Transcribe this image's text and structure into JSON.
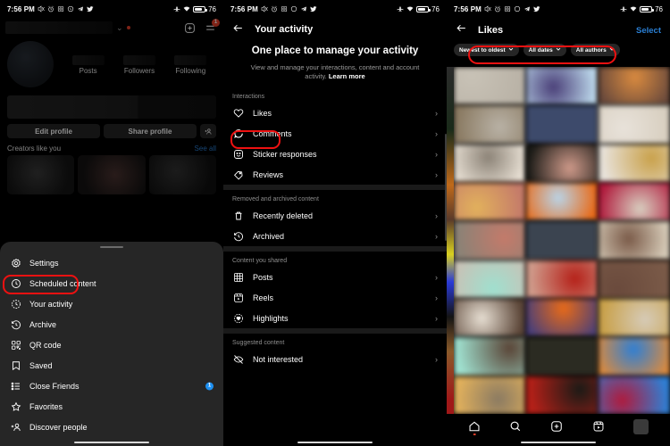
{
  "status_bar": {
    "time": "7:56 PM",
    "battery_percent": "76",
    "left_icons": [
      "mute-icon",
      "alarm-icon",
      "screenshot-icon",
      "whatsapp-icon",
      "telegram-icon",
      "twitter-icon"
    ],
    "right_icons": [
      "airplane-icon",
      "wifi-icon",
      "battery-icon"
    ]
  },
  "panel1": {
    "name": "panel-instagram-profile",
    "header": {
      "username_redacted": true,
      "chevron": "⌄",
      "add_icon": "plus-circle-icon",
      "menu_icon": "hamburger-menu-icon",
      "menu_badge": "1"
    },
    "stats": [
      {
        "label": "Posts"
      },
      {
        "label": "Followers"
      },
      {
        "label": "Following"
      }
    ],
    "buttons": {
      "edit_profile": "Edit profile",
      "share_profile": "Share profile",
      "add_person_icon": "add-person-icon"
    },
    "creators": {
      "title": "Creators like you",
      "see_all": "See all"
    },
    "sheet_items": [
      {
        "label": "Settings",
        "icon": "gear-icon",
        "badge": null,
        "highlighted": false
      },
      {
        "label": "Scheduled content",
        "icon": "clock-icon",
        "badge": null,
        "highlighted": false
      },
      {
        "label": "Your activity",
        "icon": "activity-clock-icon",
        "badge": null,
        "highlighted": true
      },
      {
        "label": "Archive",
        "icon": "archive-clock-icon",
        "badge": null,
        "highlighted": false
      },
      {
        "label": "QR code",
        "icon": "qr-code-icon",
        "badge": null,
        "highlighted": false
      },
      {
        "label": "Saved",
        "icon": "bookmark-icon",
        "badge": null,
        "highlighted": false
      },
      {
        "label": "Close Friends",
        "icon": "list-icon",
        "badge": "1",
        "highlighted": false
      },
      {
        "label": "Favorites",
        "icon": "star-icon",
        "badge": null,
        "highlighted": false
      },
      {
        "label": "Discover people",
        "icon": "discover-people-icon",
        "badge": null,
        "highlighted": false
      }
    ]
  },
  "panel2": {
    "name": "panel-your-activity",
    "back_icon": "back-arrow-icon",
    "title": "Your activity",
    "hero_title": "One place to manage your activity",
    "hero_sub_text": "View and manage your interactions, content and account activity. ",
    "hero_sub_link": "Learn more",
    "sections": [
      {
        "header": "Interactions",
        "items": [
          {
            "label": "Likes",
            "icon": "heart-icon",
            "highlighted": true
          },
          {
            "label": "Comments",
            "icon": "comment-bubble-icon",
            "highlighted": false
          },
          {
            "label": "Sticker responses",
            "icon": "sticker-face-icon",
            "highlighted": false
          },
          {
            "label": "Reviews",
            "icon": "tag-icon",
            "highlighted": false
          }
        ]
      },
      {
        "header": "Removed and archived content",
        "items": [
          {
            "label": "Recently deleted",
            "icon": "trash-icon",
            "highlighted": false
          },
          {
            "label": "Archived",
            "icon": "archive-clock-icon",
            "highlighted": false
          }
        ]
      },
      {
        "header": "Content you shared",
        "items": [
          {
            "label": "Posts",
            "icon": "grid-icon",
            "highlighted": false
          },
          {
            "label": "Reels",
            "icon": "reels-icon",
            "highlighted": false
          },
          {
            "label": "Highlights",
            "icon": "highlights-icon",
            "highlighted": false
          }
        ]
      },
      {
        "header": "Suggested content",
        "items": [
          {
            "label": "Not interested",
            "icon": "eye-off-icon",
            "highlighted": false
          }
        ]
      }
    ],
    "chevron": "›"
  },
  "panel3": {
    "name": "panel-likes",
    "back_icon": "back-arrow-icon",
    "title": "Likes",
    "select_label": "Select",
    "filters": [
      {
        "label": "Newest to oldest",
        "icon": "chevron-down-icon"
      },
      {
        "label": "All dates",
        "icon": "chevron-down-icon"
      },
      {
        "label": "All authors",
        "icon": "chevron-down-icon"
      }
    ],
    "filters_highlighted": true,
    "grid_cells": [
      "#c8c2b6",
      "#4a3f78",
      "#d98a3f",
      "#b9b2a6",
      "#3d4a6b",
      "#e8e2da",
      "#8b8276",
      "#cf9a8a",
      "#c9a14a",
      "#e2b15c",
      "#b9d4e8",
      "#d8cfc0",
      "#c47a6a",
      "#3b4450",
      "#7a5a48",
      "#9fe0cf",
      "#b52018",
      "#6a4a3c",
      "#e8e0d4",
      "#e86a18",
      "#d6cbb8",
      "#5a4436",
      "#2b2b22",
      "#2f7fd4",
      "#8a7a62",
      "#1a1a16",
      "#b01a3c"
    ],
    "nav": [
      {
        "icon": "home-icon",
        "active": true
      },
      {
        "icon": "search-icon",
        "active": false
      },
      {
        "icon": "create-icon",
        "active": false
      },
      {
        "icon": "reels-nav-icon",
        "active": false
      },
      {
        "icon": "profile-avatar",
        "active": false
      }
    ]
  },
  "colors": {
    "highlight_red": "#ee1111",
    "link_blue": "#2a7fd4",
    "badge_blue": "#1d8ff0",
    "badge_red": "#e8402a",
    "sheet_bg": "#262626",
    "page_bg": "#000000"
  }
}
